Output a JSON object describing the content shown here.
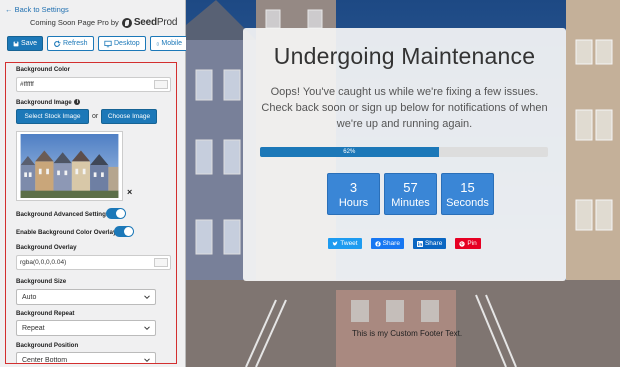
{
  "sidebar": {
    "back_link": "← Back to Settings",
    "app_title": "Coming Soon Page Pro by",
    "brand": {
      "bold": "Seed",
      "light": "Prod"
    },
    "toolbar": {
      "save": "Save",
      "refresh": "Refresh",
      "desktop": "Desktop",
      "mobile": "Mobile"
    },
    "settings": {
      "bg_color_label": "Background Color",
      "bg_color_value": "#ffffff",
      "bg_image_label": "Background Image",
      "select_stock": "Select Stock Image",
      "or": "or",
      "choose_image": "Choose Image",
      "advanced_label": "Background Advanced Settings",
      "enable_overlay_label": "Enable Background Color Overlay",
      "overlay_label": "Background Overlay",
      "overlay_value": "rgba(0,0,0,0.04)",
      "size_label": "Background Size",
      "size_value": "Auto",
      "repeat_label": "Background Repeat",
      "repeat_value": "Repeat",
      "position_label": "Background Position",
      "position_value": "Center Bottom"
    }
  },
  "preview": {
    "headline": "Undergoing Maintenance",
    "description": "Oops! You've caught us while we're fixing a few issues. Check back soon or sign up below for notifications of when we're up and running again.",
    "progress_label": "62%",
    "progress_value": 62,
    "countdown": [
      {
        "num": "3",
        "label": "Hours"
      },
      {
        "num": "57",
        "label": "Minutes"
      },
      {
        "num": "15",
        "label": "Seconds"
      }
    ],
    "share": {
      "tweet": "Tweet",
      "fb": "Share",
      "li": "Share",
      "pin": "Pin"
    },
    "footer": "This is my Custom Footer Text."
  },
  "colors": {
    "accent": "#1c78b8",
    "countdown": "#3a86d6",
    "highlight_border": "#d32f2f"
  }
}
